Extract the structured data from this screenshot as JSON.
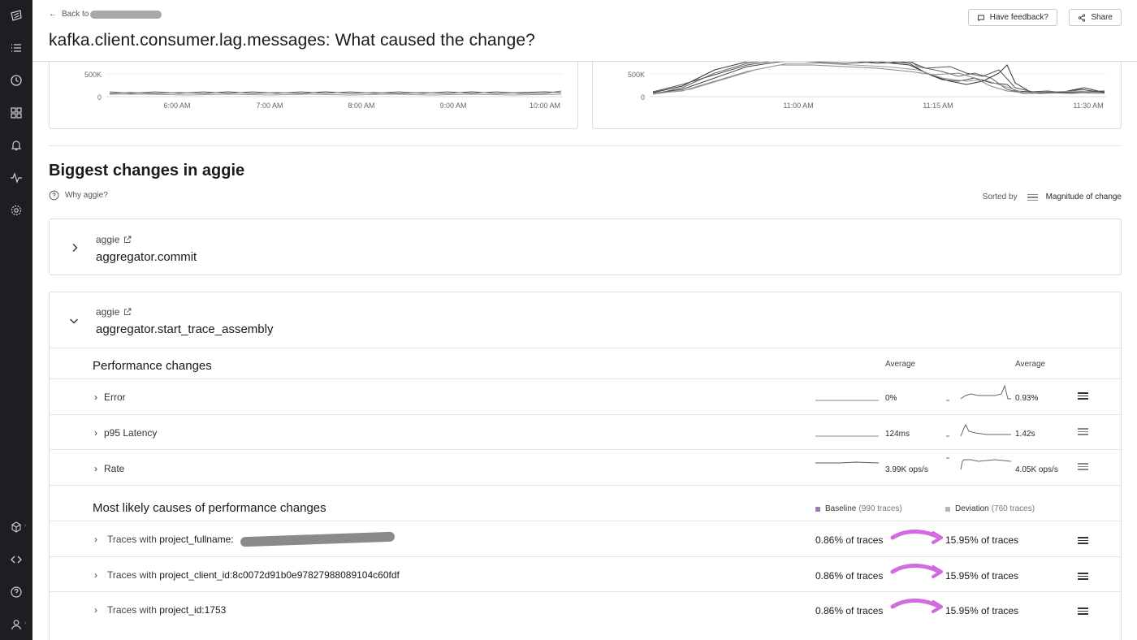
{
  "header": {
    "back_label": "Back to",
    "title": "kafka.client.consumer.lag.messages: What caused the change?",
    "feedback_label": "Have feedback?",
    "share_label": "Share"
  },
  "left_chart": {
    "y_ticks": [
      "500K",
      "0"
    ],
    "x_ticks": [
      "6:00 AM",
      "7:00 AM",
      "8:00 AM",
      "9:00 AM",
      "10:00 AM"
    ]
  },
  "right_chart": {
    "y_ticks": [
      "500K",
      "0"
    ],
    "x_ticks": [
      "11:00 AM",
      "11:15 AM",
      "11:30 AM"
    ]
  },
  "section": {
    "title": "Biggest changes in aggie",
    "why_label": "Why aggie?",
    "sorted_by_label": "Sorted by",
    "sorted_by_value": "Magnitude of change"
  },
  "cards": [
    {
      "service": "aggie",
      "operation": "aggregator.commit",
      "expanded": false
    },
    {
      "service": "aggie",
      "operation": "aggregator.start_trace_assembly",
      "expanded": true
    }
  ],
  "performance": {
    "title": "Performance changes",
    "col_baseline": "Average",
    "col_deviation": "Average",
    "metrics": [
      {
        "name": "Error",
        "baseline": "0%",
        "deviation": "0.93%"
      },
      {
        "name": "p95 Latency",
        "baseline": "124ms",
        "deviation": "1.42s"
      },
      {
        "name": "Rate",
        "baseline": "3.99K ops/s",
        "deviation": "4.05K ops/s"
      }
    ]
  },
  "causes": {
    "title": "Most likely causes of performance changes",
    "baseline_label": "Baseline",
    "baseline_count": "(990 traces)",
    "deviation_label": "Deviation",
    "deviation_count": "(760 traces)",
    "rows": [
      {
        "prefix": "Traces with",
        "key": "project_fullname:",
        "baseline": "0.86% of traces",
        "deviation": "15.95% of traces"
      },
      {
        "prefix": "Traces with",
        "key": "project_client_id:8c0072d91b0e97827988089104c60fdf",
        "baseline": "0.86% of traces",
        "deviation": "15.95% of traces"
      },
      {
        "prefix": "Traces with",
        "key": "project_id:1753",
        "baseline": "0.86% of traces",
        "deviation": "15.95% of traces"
      }
    ]
  },
  "colors": {
    "rail": "#1d1d22",
    "baseline_swatch": "#9b7bb0",
    "deviation_swatch": "#b9b4bd",
    "annotation_arrow": "#d36be0"
  },
  "icons": {
    "rail": [
      "logo-icon",
      "list-icon",
      "clock-icon",
      "grid-icon",
      "bell-icon",
      "activity-icon",
      "gear-icon",
      "cube-icon",
      "code-icon",
      "help-icon",
      "user-icon"
    ]
  }
}
